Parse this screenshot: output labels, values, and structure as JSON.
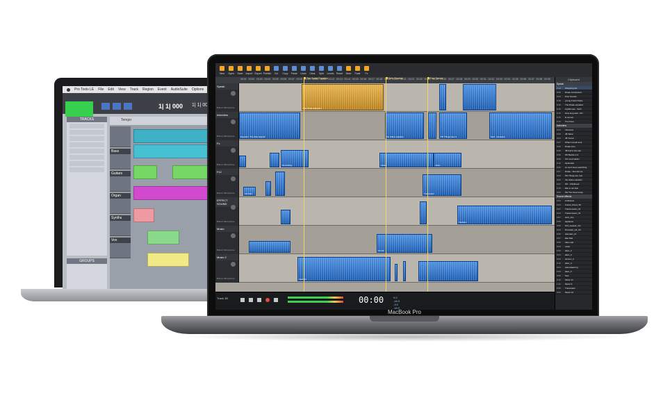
{
  "protools": {
    "menus": [
      "Pro Tools LE",
      "File",
      "Edit",
      "View",
      "Track",
      "Region",
      "Event",
      "AudioSuite",
      "Options"
    ],
    "counter_main": "1| 1| 000",
    "counter_side": "1| 1| 000",
    "tracks_header": "TRACKS",
    "groups_header": "GROUPS",
    "ruler_label": "Tempo",
    "track_names": [
      "Bass",
      "Guitars",
      "Organ",
      "Synths",
      "Vox"
    ]
  },
  "hindenburg": {
    "toolbar": [
      "New",
      "Open",
      "Save",
      "Import",
      "Export",
      "Publish",
      "Cut",
      "Copy",
      "Paste",
      "Undo",
      "Clear",
      "Split",
      "Levels",
      "Reset",
      "Mute",
      "Fade",
      "Fx"
    ],
    "ruler_ticks": [
      "00:01",
      "00:02",
      "00:03",
      "00:04",
      "00:05",
      "00:06",
      "00:07",
      "00:08",
      "00:09",
      "00:10",
      "00:11",
      "00:12",
      "00:13",
      "00:14",
      "00:15",
      "00:16",
      "00:17",
      "00:18",
      "00:19",
      "00:20",
      "00:21",
      "00:22",
      "00:23",
      "00:24",
      "00:25",
      "00:26",
      "00:27",
      "00:28",
      "00:29",
      "00:30",
      "00:31",
      "00:32",
      "00:33",
      "00:34",
      "00:35",
      "00:36",
      "00:37",
      "00:38",
      "00:39"
    ],
    "markers": [
      "The Drake Equation",
      "Seth Shostak",
      "Paul Davies"
    ],
    "tracks": [
      {
        "name": "Speak",
        "input": "Built-in Microphone"
      },
      {
        "name": "Interview",
        "input": "Built-in Microphone"
      },
      {
        "name": "Fx",
        "input": "Built-in Microphone"
      },
      {
        "name": "Fx2",
        "input": "Built-in Microphone"
      },
      {
        "name": "EFFECT SOUND",
        "input": "Built-in Microphone"
      },
      {
        "name": "Music",
        "input": "Built-in Microphone"
      },
      {
        "name": "Music 2",
        "input": "Built-in Microphone"
      }
    ],
    "clip_names": [
      "The Drake Equation",
      "Drake introduction",
      "Equation: The Alien Equati",
      "Grounding",
      "Grounding",
      "the drake equation",
      "PD Things (we re",
      "Seth - Aussians",
      "noise",
      "noise",
      "Old Sail",
      "Transwater",
      "treetops",
      "choral",
      "treetops"
    ],
    "transport_time": "00:00",
    "track_button": "Track 1B",
    "clipboard_title": "Clipboard",
    "clipboard_groups": [
      "Speak",
      "Interview",
      "Sound effects"
    ],
    "clipboard_rows": [
      {
        "t": "0:10",
        "n": "Shopping list"
      },
      {
        "t": "0:08",
        "n": "Drake introduction"
      },
      {
        "t": "0:03",
        "n": "Pool Grande"
      },
      {
        "t": "0:18",
        "n": "young Frank Drake"
      },
      {
        "t": "0:16",
        "n": "The Drake equation"
      },
      {
        "t": "0:15",
        "n": "Lighthouse - Seth"
      },
      {
        "t": "0:15",
        "n": "How long wait - PD"
      },
      {
        "t": "0:13",
        "n": "E-nemes"
      },
      {
        "t": "0:13",
        "n": "Two there"
      },
      {
        "t": "0:04",
        "n": "Interview"
      },
      {
        "t": "0:05",
        "n": "JB Tarter"
      },
      {
        "t": "0:04",
        "n": "JB Turner"
      },
      {
        "t": "0:07",
        "n": "What it would look"
      },
      {
        "t": "0:05",
        "n": "Drake intro"
      },
      {
        "t": "0:05",
        "n": "JB Fell in the rain"
      },
      {
        "t": "0:09",
        "n": "PD Beetle in d"
      },
      {
        "t": "0:08",
        "n": "FD Look harder"
      },
      {
        "t": "0:10",
        "n": "Optimistic"
      },
      {
        "t": "0:06",
        "n": "so we'd keep searching"
      },
      {
        "t": "0:07",
        "n": "Drake - Sounds we"
      },
      {
        "t": "0:03",
        "n": "PD Things are reel"
      },
      {
        "t": "0:06",
        "n": "the drake equation"
      },
      {
        "t": "0:07",
        "n": "PD - Childhood"
      },
      {
        "t": "0:15",
        "n": "Elle is not that"
      },
      {
        "t": "0:06",
        "n": "PD The Final recap"
      },
      {
        "t": "0:03",
        "n": "Ambience"
      },
      {
        "t": "0:04",
        "n": "Forest_Flood_Wi"
      },
      {
        "t": "0:07",
        "n": "Transmission_W"
      },
      {
        "t": "0:04",
        "n": "Transmission_W"
      },
      {
        "t": "0:07",
        "n": "amb_rain"
      },
      {
        "t": "0:05",
        "n": "applause"
      },
      {
        "t": "0:05",
        "n": "bird_squeak_mix"
      },
      {
        "t": "0:04",
        "n": "Dramatic_Hit_Ch"
      },
      {
        "t": "0:05",
        "n": "dramatic_ch"
      },
      {
        "t": "0:07",
        "n": "Elle Dial"
      },
      {
        "t": "0:05",
        "n": "Alien spk"
      },
      {
        "t": "0:03",
        "n": "noise"
      },
      {
        "t": "0:06",
        "n": "alien_2"
      },
      {
        "t": "0:04",
        "n": "alien_3"
      },
      {
        "t": "0:03",
        "n": "tension_2"
      },
      {
        "t": "0:10",
        "n": "alien_4"
      },
      {
        "t": "0:04",
        "n": "tearnwaterrng"
      },
      {
        "t": "0:05",
        "n": "alien_5"
      },
      {
        "t": "0:05",
        "n": "Sea"
      },
      {
        "t": "0:10",
        "n": "Music 11"
      },
      {
        "t": "1:41",
        "n": "Music 9"
      },
      {
        "t": "0:05",
        "n": "Transwater"
      },
      {
        "t": "0:06",
        "n": "Music 12"
      }
    ],
    "level_readout": [
      "0.0",
      "-18.0",
      "-3.0",
      "-18.0"
    ]
  },
  "laptop": {
    "brand": "MacBook Pro"
  },
  "colors": {
    "clip_blue": "#2c6fc6",
    "clip_orange": "#d39b32",
    "track_bg": "#b4afa7",
    "pt_green": "#37d04e"
  }
}
